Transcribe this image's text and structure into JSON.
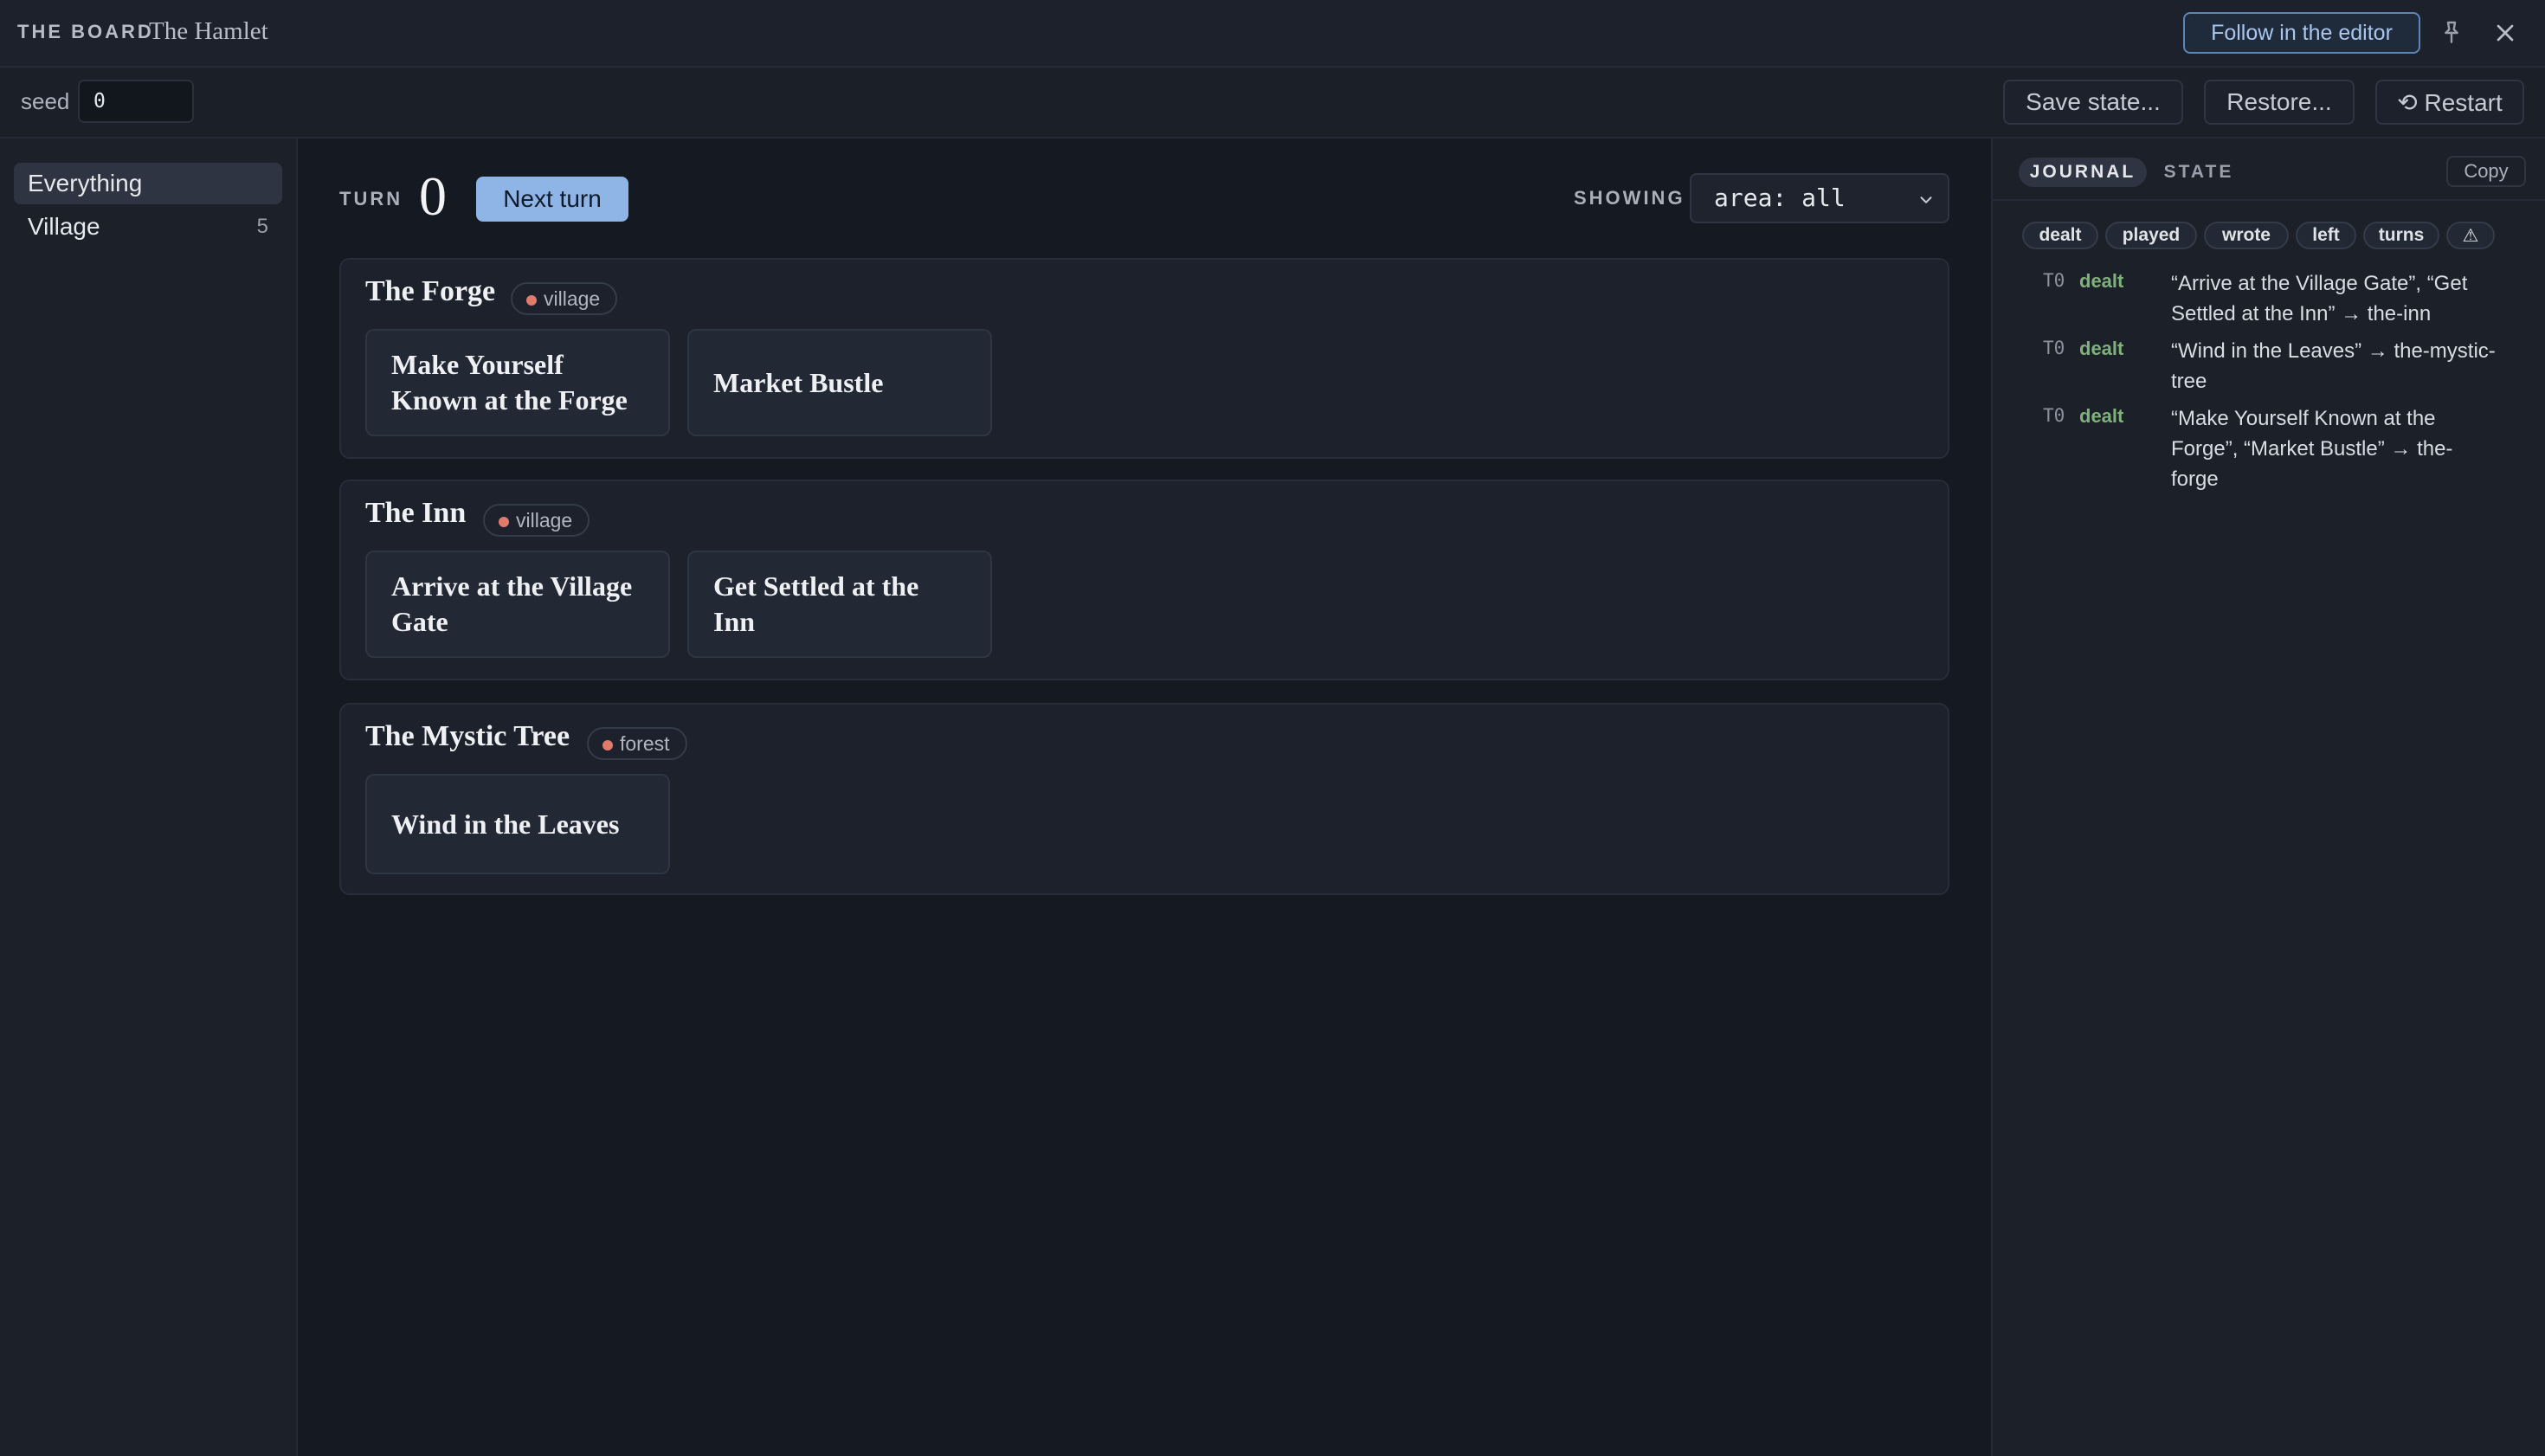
{
  "header": {
    "brand": "THE BOARD",
    "board_name": "The Hamlet",
    "follow_label": "Follow in the editor",
    "pin_icon": "pin-icon",
    "close_icon": "close-icon"
  },
  "toolbar": {
    "seed_label": "seed",
    "seed_value": "0",
    "save_label": "Save state...",
    "restore_label": "Restore...",
    "restart_label": "⟲ Restart"
  },
  "sidebar": {
    "items": [
      {
        "label": "Everything",
        "count": ""
      },
      {
        "label": "Village",
        "count": "5"
      }
    ]
  },
  "main": {
    "turn_label": "TURN",
    "turn_number": "0",
    "next_turn_label": "Next turn",
    "showing_label": "SHOWING",
    "filter_value": "area: all",
    "areas": [
      {
        "title": "The Forge",
        "tag": "village",
        "cards": [
          "Make Yourself Known at the Forge",
          "Market Bustle"
        ]
      },
      {
        "title": "The Inn",
        "tag": "village",
        "cards": [
          "Arrive at the Village Gate",
          "Get Settled at the Inn"
        ]
      },
      {
        "title": "The Mystic Tree",
        "tag": "forest",
        "cards": [
          "Wind in the Leaves"
        ]
      }
    ],
    "tag_dot_color": "#e07a6a"
  },
  "journal": {
    "tab_journal": "JOURNAL",
    "tab_state": "STATE",
    "copy_label": "Copy",
    "filters": [
      "dealt",
      "played",
      "wrote",
      "left",
      "turns",
      "⚠"
    ],
    "entries": [
      {
        "turn": "T0",
        "kind": "dealt",
        "text": "“Arrive at the Village Gate”, “Get Settled at the Inn” → the-inn"
      },
      {
        "turn": "T0",
        "kind": "dealt",
        "text": "“Wind in the Leaves” → the-mystic-tree"
      },
      {
        "turn": "T0",
        "kind": "dealt",
        "text": "“Make Yourself Known at the Forge”, “Market Bustle” → the-forge"
      }
    ],
    "kind_color": "#7fb27a"
  }
}
